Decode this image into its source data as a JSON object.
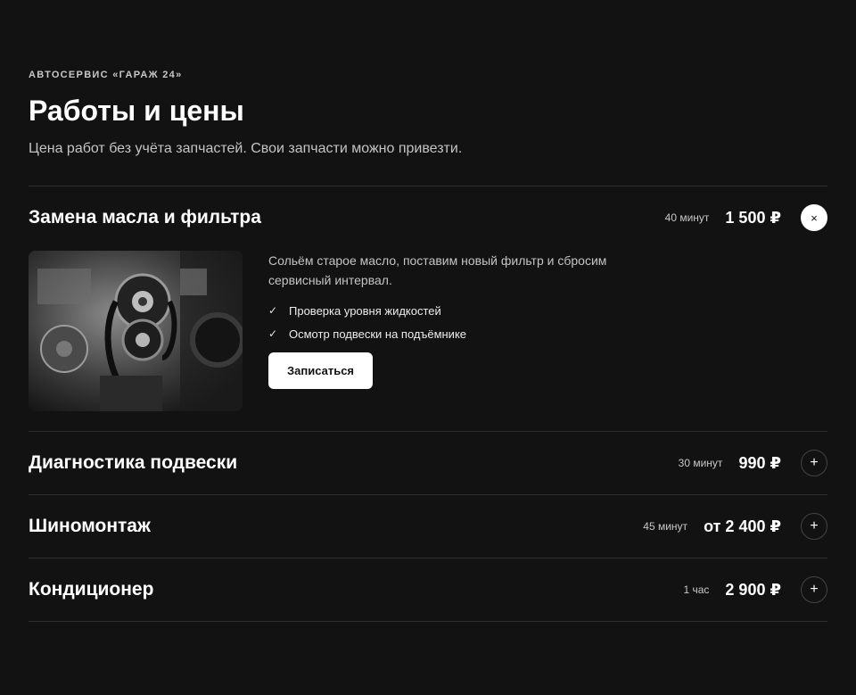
{
  "header": {
    "eyebrow": "АВТОСЕРВИС «ГАРАЖ 24»",
    "title": "Работы и цены",
    "subtitle": "Цена работ без учёта запчастей. Свои запчасти можно привезти."
  },
  "services": [
    {
      "name": "Замена масла и фильтра",
      "duration": "40 минут",
      "price": "1 500 ₽",
      "toggle_icon": "close-icon",
      "toggle_glyph": "×",
      "expanded": true,
      "description": "Сольём старое масло, поставим новый фильтр и сбросим сервисный интервал.",
      "features": [
        "Проверка уровня жидкостей",
        "Осмотр подвески на подъёмнике"
      ],
      "cta_label": "Записаться"
    },
    {
      "name": "Диагностика подвески",
      "duration": "30 минут",
      "price": "990 ₽",
      "toggle_icon": "plus-icon",
      "toggle_glyph": "+"
    },
    {
      "name": "Шиномонтаж",
      "duration": "45 минут",
      "price": "от 2 400 ₽",
      "toggle_icon": "plus-icon",
      "toggle_glyph": "+"
    },
    {
      "name": "Кондиционер",
      "duration": "1 час",
      "price": "2 900 ₽",
      "toggle_icon": "plus-icon",
      "toggle_glyph": "+"
    }
  ],
  "check_glyph": "✓",
  "colors": {
    "background": "#121212",
    "text": "#ffffff",
    "muted": "#c4c4c4",
    "divider": "#2e2e2e"
  }
}
